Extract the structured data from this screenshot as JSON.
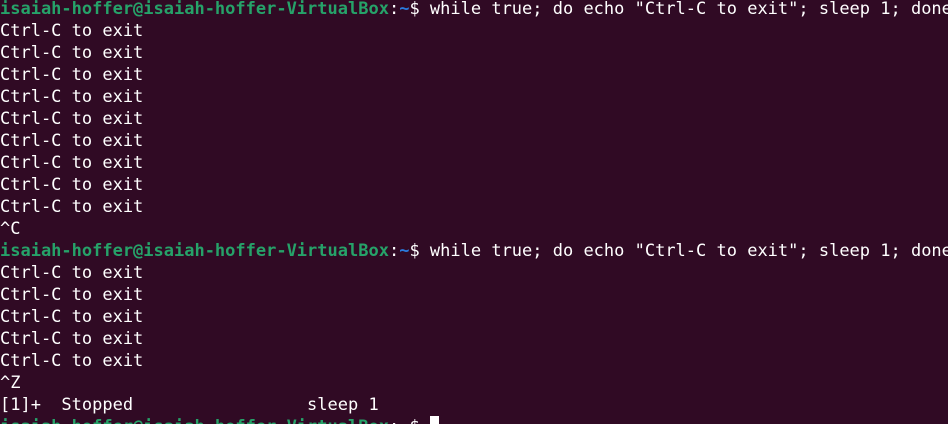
{
  "terminal": {
    "prompt": {
      "user_host": "isaiah-hoffer@isaiah-hoffer-VirtualBox",
      "separator": ":",
      "path": "~",
      "symbol": "$ "
    },
    "lines": [
      {
        "kind": "prompt",
        "text": "while true; do echo \"Ctrl-C to exit\"; sleep 1; done"
      },
      {
        "kind": "output",
        "text": "Ctrl-C to exit"
      },
      {
        "kind": "output",
        "text": "Ctrl-C to exit"
      },
      {
        "kind": "output",
        "text": "Ctrl-C to exit"
      },
      {
        "kind": "output",
        "text": "Ctrl-C to exit"
      },
      {
        "kind": "output",
        "text": "Ctrl-C to exit"
      },
      {
        "kind": "output",
        "text": "Ctrl-C to exit"
      },
      {
        "kind": "output",
        "text": "Ctrl-C to exit"
      },
      {
        "kind": "output",
        "text": "Ctrl-C to exit"
      },
      {
        "kind": "output",
        "text": "Ctrl-C to exit"
      },
      {
        "kind": "output",
        "text": "^C"
      },
      {
        "kind": "prompt",
        "text": "while true; do echo \"Ctrl-C to exit\"; sleep 1; done"
      },
      {
        "kind": "output",
        "text": "Ctrl-C to exit"
      },
      {
        "kind": "output",
        "text": "Ctrl-C to exit"
      },
      {
        "kind": "output",
        "text": "Ctrl-C to exit"
      },
      {
        "kind": "output",
        "text": "Ctrl-C to exit"
      },
      {
        "kind": "output",
        "text": "Ctrl-C to exit"
      },
      {
        "kind": "output",
        "text": "^Z"
      },
      {
        "kind": "output",
        "text": "[1]+  Stopped                 sleep 1"
      },
      {
        "kind": "prompt",
        "text": ""
      }
    ],
    "colors": {
      "background": "#300a24",
      "user_host": "#26a269",
      "path": "#2a7bde",
      "text": "#ffffff"
    }
  }
}
